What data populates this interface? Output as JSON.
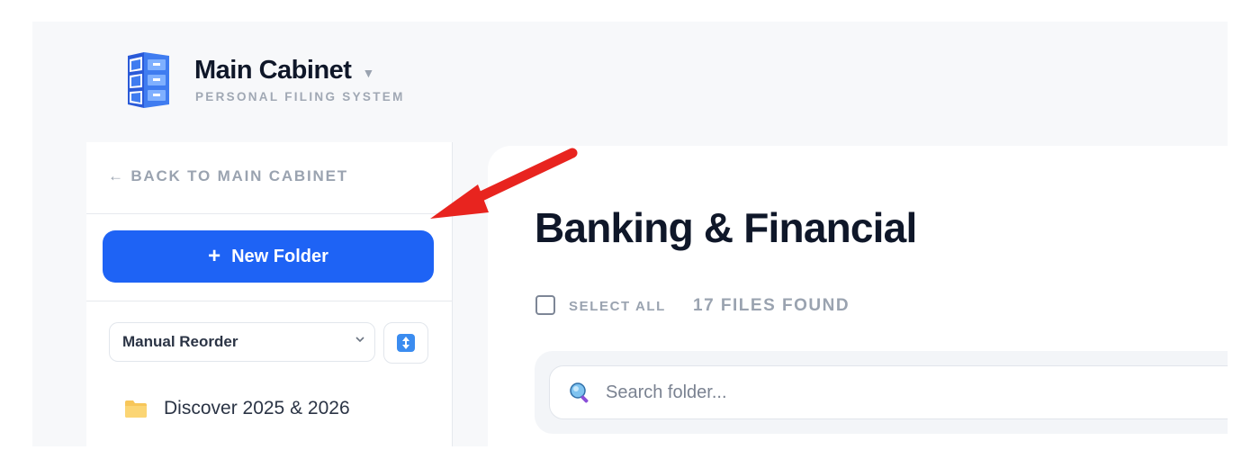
{
  "header": {
    "title": "Main Cabinet",
    "subtitle": "PERSONAL FILING SYSTEM",
    "logo_icon": "file-cabinet-icon",
    "dropdown_icon": "caret-down-icon"
  },
  "sidebar": {
    "back_label": "← BACK TO MAIN CABINET",
    "new_folder_label": "New Folder",
    "new_folder_icon": "plus-icon",
    "sort_select": {
      "selected": "Manual Reorder"
    },
    "sort_toggle_icon": "sort-arrows-icon",
    "folders": [
      {
        "label": "Discover 2025 & 2026",
        "icon": "folder-icon"
      }
    ]
  },
  "main": {
    "title": "Banking & Financial",
    "select_all_label": "SELECT ALL",
    "files_found": "17 FILES FOUND",
    "search": {
      "placeholder": "Search folder...",
      "value": ""
    }
  },
  "annotation": {
    "arrow_color": "#e8241f"
  },
  "colors": {
    "accent": "#1e63f5",
    "folder": "#f7c65a",
    "muted_text": "#9aa3b0",
    "heading": "#0f1729"
  }
}
